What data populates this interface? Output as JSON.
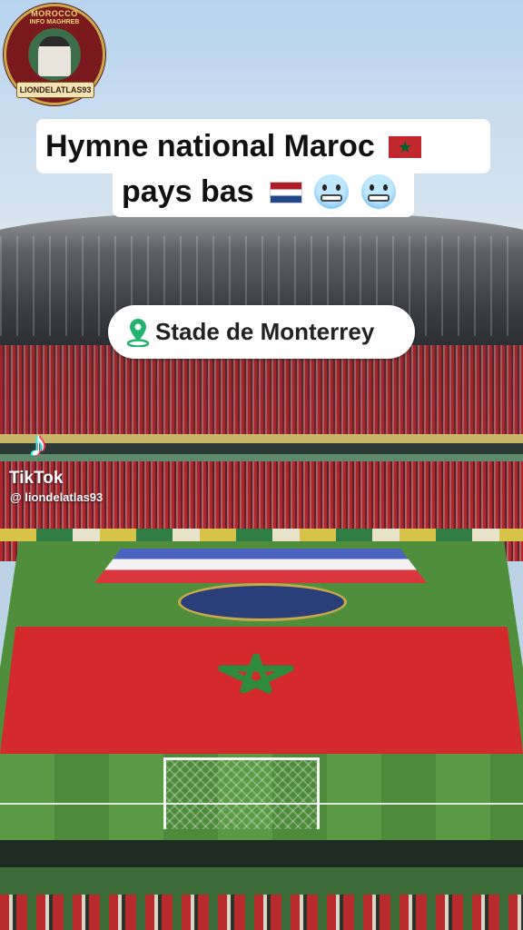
{
  "logo": {
    "top_text": "MOROCCO",
    "sub_text": "INFO MAGHREB",
    "banner_text": "LIONDELATLAS93"
  },
  "title": {
    "line1": "Hymne national Maroc",
    "line2": "pays bas",
    "flag1": "morocco-flag-icon",
    "flag2": "netherlands-flag-icon",
    "emoji": "grimacing-cold-face-icon"
  },
  "location": {
    "icon": "map-pin-icon",
    "label": "Stade de Monterrey"
  },
  "watermark": {
    "brand": "TikTok",
    "handle": "@ liondelatlas93"
  },
  "colors": {
    "morocco_red": "#c1272d",
    "morocco_green": "#006233",
    "pin_green": "#1fb36b"
  }
}
